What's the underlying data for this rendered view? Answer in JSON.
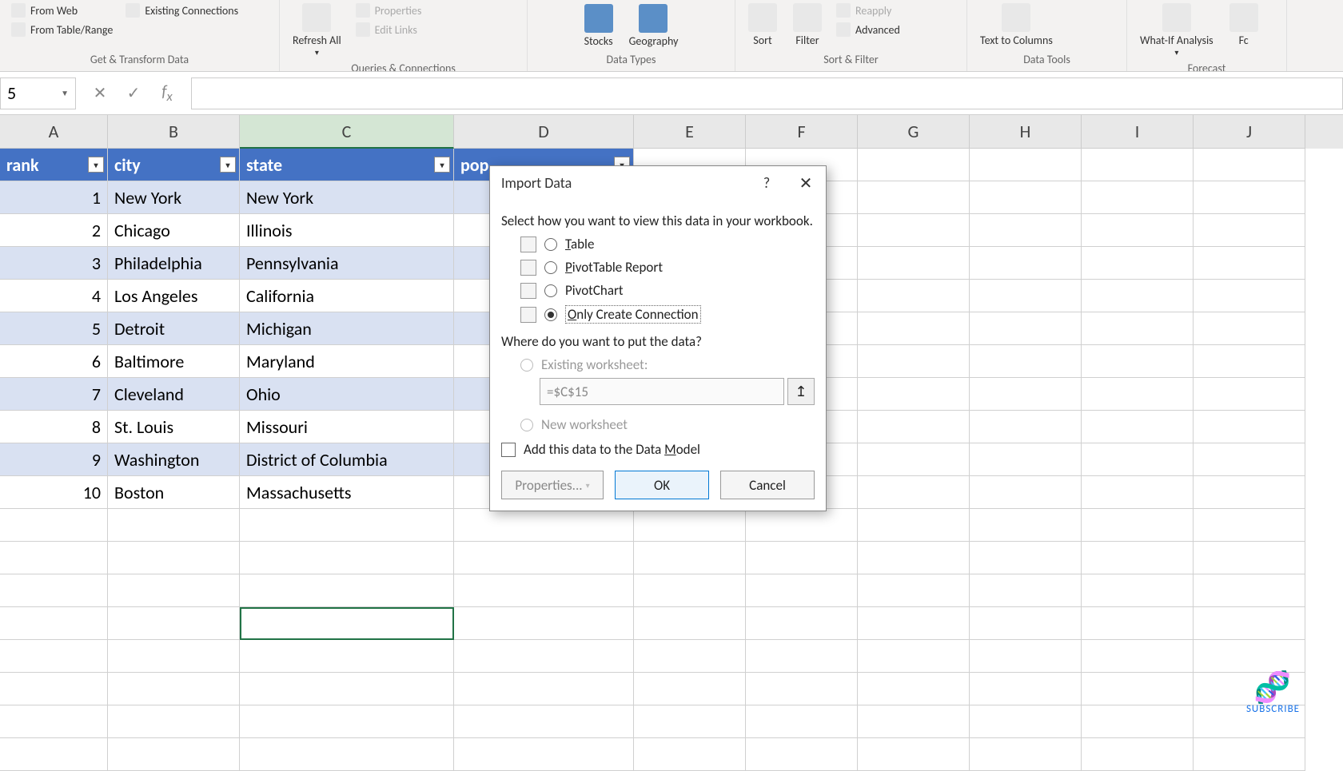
{
  "ribbon": {
    "group1": {
      "from_web": "From Web",
      "from_table": "From Table/Range",
      "existing": "Existing Connections",
      "label": "Get & Transform Data"
    },
    "group2": {
      "refresh": "Refresh All",
      "properties": "Properties",
      "edit_links": "Edit Links",
      "label": "Queries & Connections"
    },
    "group3": {
      "stocks": "Stocks",
      "geography": "Geography",
      "label": "Data Types"
    },
    "group4": {
      "sort": "Sort",
      "filter": "Filter",
      "reapply": "Reapply",
      "advanced": "Advanced",
      "label": "Sort & Filter"
    },
    "group5": {
      "text_to_cols": "Text to Columns",
      "label": "Data Tools"
    },
    "group6": {
      "what_if": "What-If Analysis",
      "fc": "Fc",
      "label": "Forecast"
    }
  },
  "name_box": "5",
  "columns": [
    "A",
    "B",
    "C",
    "D",
    "E",
    "F",
    "G",
    "H",
    "I",
    "J"
  ],
  "table": {
    "headers": [
      "rank",
      "city",
      "state",
      "pop"
    ],
    "rows": [
      {
        "rank": "1",
        "city": "New York",
        "state": "New York"
      },
      {
        "rank": "2",
        "city": "Chicago",
        "state": "Illinois"
      },
      {
        "rank": "3",
        "city": "Philadelphia",
        "state": "Pennsylvania"
      },
      {
        "rank": "4",
        "city": "Los Angeles",
        "state": "California"
      },
      {
        "rank": "5",
        "city": "Detroit",
        "state": "Michigan"
      },
      {
        "rank": "6",
        "city": "Baltimore",
        "state": "Maryland"
      },
      {
        "rank": "7",
        "city": "Cleveland",
        "state": "Ohio"
      },
      {
        "rank": "8",
        "city": "St. Louis",
        "state": "Missouri"
      },
      {
        "rank": "9",
        "city": "Washington",
        "state": "District of Columbia"
      },
      {
        "rank": "10",
        "city": "Boston",
        "state": "Massachusetts"
      }
    ]
  },
  "dialog": {
    "title": "Import Data",
    "prompt": "Select how you want to view this data in your workbook.",
    "opt_table": "able",
    "opt_pivot": "ivotTable Report",
    "opt_chart": "PivotChart",
    "opt_conn": "nly Create Connection",
    "where": "Where do you want to put the data?",
    "existing": "Existing worksheet:",
    "loc": "=$C$15",
    "new_ws": "New worksheet",
    "add_model": "Add this data to the Data ",
    "add_model_u": "M",
    "add_model2": "odel",
    "props": "Properties...",
    "ok": "OK",
    "cancel": "Cancel"
  },
  "subscribe": "SUBSCRIBE"
}
